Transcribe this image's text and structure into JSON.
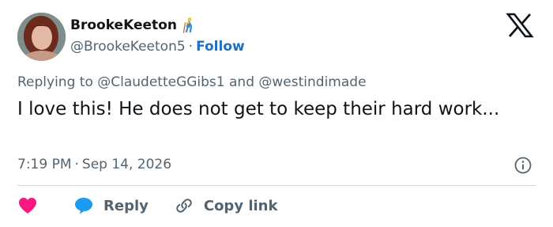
{
  "user": {
    "display_name": "BrookeKeeton",
    "handle": "@BrookeKeeton5",
    "separator": "·",
    "follow_label": "Follow",
    "name_emoji": "walking-person-with-cane-emoji"
  },
  "reply_context": {
    "prefix": "Replying to",
    "mention_1": "@ClaudetteGGibs1",
    "conjunction": "and",
    "mention_2": "@westindimade"
  },
  "tweet": {
    "text": "I love this! He does not get to keep their hard work..."
  },
  "meta": {
    "time": "7:19 PM",
    "separator": "·",
    "date": "Sep 14, 2026"
  },
  "actions": {
    "reply_label": "Reply",
    "copy_link_label": "Copy link"
  },
  "icons": {
    "logo": "x-logo-icon",
    "info": "info-icon",
    "like": "heart-icon",
    "reply": "reply-bubble-icon",
    "copy": "link-icon"
  },
  "colors": {
    "follow": "#1d70c4",
    "like": "#f91880",
    "reply": "#1d9bf0",
    "secondary_text": "#536471",
    "primary_text": "#0f1419"
  }
}
